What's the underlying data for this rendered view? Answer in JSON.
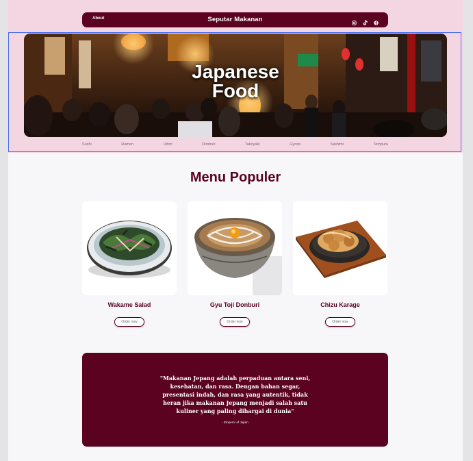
{
  "navbar": {
    "about_label": "About",
    "title": "Seputar Makanan",
    "icons": [
      "instagram-icon",
      "tiktok-icon",
      "facebook-icon"
    ]
  },
  "hero": {
    "title_line1": "Japanese",
    "title_line2": "Food"
  },
  "categories": [
    "Sushi",
    "Ramen",
    "Udon",
    "Donburi",
    "Takoyaki",
    "Gyoza",
    "Sashimi",
    "Tempura"
  ],
  "menu": {
    "title": "Menu Populer",
    "items": [
      {
        "name": "Wakame Salad",
        "button": "Order now"
      },
      {
        "name": "Gyu Toji Donburi",
        "button": "Order now"
      },
      {
        "name": "Chizu Karage",
        "button": "Order now"
      }
    ]
  },
  "quote": {
    "text": "\"Makanan Jepang adalah perpaduan antara seni, kesehatan, dan rasa. Dengan bahan segar, presentasi indah, dan rasa yang autentik, tidak heran jika makanan Jepang menjadi salah satu kuliner yang paling dihargai di dunia\"",
    "author": "- Emperor of Japan"
  },
  "colors": {
    "primary": "#5a0220",
    "hero_band": "#f4d6e2",
    "page_bg": "#f7f7fa",
    "selection": "#4a6cf0"
  }
}
